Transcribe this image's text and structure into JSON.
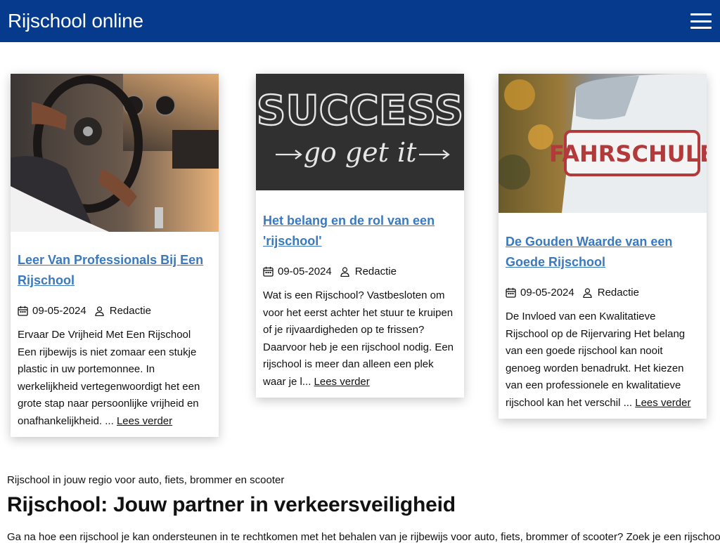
{
  "header": {
    "site_title": "Rijschool online",
    "menu_icon": "hamburger-menu-icon",
    "background": "#053a8c"
  },
  "posts": [
    {
      "image": "steering-wheel-photo",
      "title": "Leer Van Professionals Bij Een Rijschool",
      "date": "09-05-2024",
      "author": "Redactie",
      "excerpt": "Ervaar De Vrijheid Met Een Rijschool Een rijbewijs is niet zomaar een stukje plastic in uw portemonnee. In werkelijkheid vertegenwoordigt het een grote stap naar persoonlijke vrijheid en onafhankelijkheid. ...",
      "read_more": "Lees verder"
    },
    {
      "image": "success-chalkboard-photo",
      "title": "Het belang en de rol van een 'rijschool'",
      "date": "09-05-2024",
      "author": "Redactie",
      "excerpt": "Wat is een Rijschool? Vastbesloten om voor het eerst achter het stuur te kruipen of je rijvaardigheden op te frissen? Daarvoor heb je een rijschool nodig. Een rijschool is meer dan alleen een plek waar je l...",
      "read_more": "Lees verder"
    },
    {
      "image": "fahrschule-car-photo",
      "title": "De Gouden Waarde van een Goede Rijschool",
      "date": "09-05-2024",
      "author": "Redactie",
      "excerpt": "De Invloed van een Kwalitatieve Rijschool op de Rijervaring Het belang van een goede rijschool kan nooit genoeg worden benadrukt. Het kiezen van een professionele en kwalitatieve rijschool kan het verschil ...",
      "read_more": "Lees verder"
    }
  ],
  "section": {
    "tagline": "Rijschool in jouw regio voor auto, fiets, brommer en scooter",
    "heading": "Rijschool: Jouw partner in verkeersveiligheid",
    "intro": "Ga na hoe een rijschool je kan ondersteunen in te rechtkomen met het behalen van je rijbewijs voor auto, fiets, brommer of scooter? Zoek je een rijschool in"
  },
  "colors": {
    "link": "#3a79bd",
    "text": "#111111"
  }
}
